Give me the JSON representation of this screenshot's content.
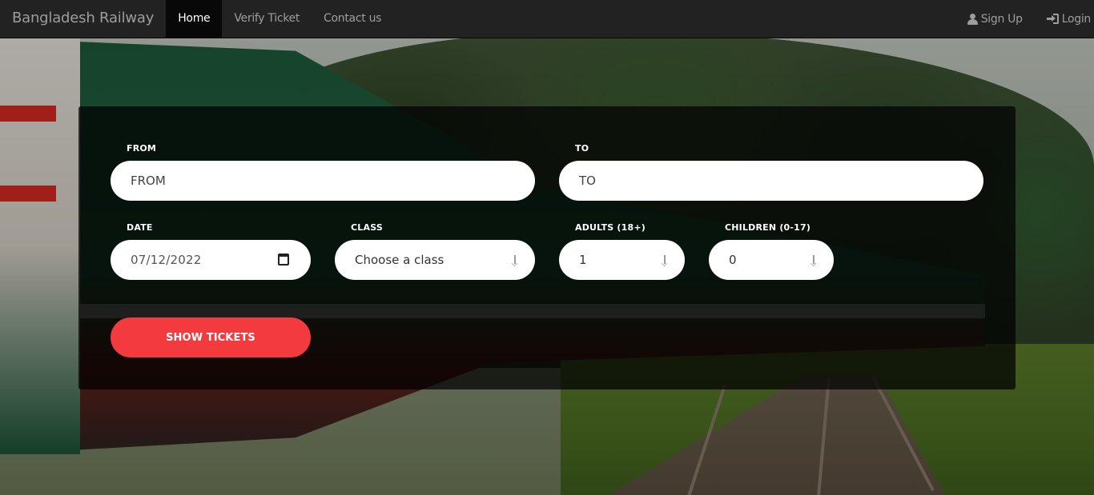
{
  "navbar": {
    "brand": "Bangladesh Railway",
    "links": [
      {
        "label": "Home",
        "active": true
      },
      {
        "label": "Verify Ticket",
        "active": false
      },
      {
        "label": "Contact us",
        "active": false
      }
    ],
    "signup_label": "Sign Up",
    "login_label": "Login"
  },
  "search": {
    "from_label": "FROM",
    "from_placeholder": "FROM",
    "to_label": "TO",
    "to_placeholder": "TO",
    "date_label": "DATE",
    "date_value": "07/12/2022",
    "class_label": "CLASS",
    "class_value": "Choose a class",
    "adults_label": "ADULTS (18+)",
    "adults_value": "1",
    "children_label": "CHILDREN (0-17)",
    "children_value": "0",
    "submit_label": "SHOW TICKETS"
  },
  "colors": {
    "navbar_bg": "#222222",
    "accent_button": "#f23a3f",
    "panel_bg": "rgba(0,0,0,0.72)"
  },
  "icons": {
    "signup": "user-icon",
    "login": "login-icon",
    "date": "calendar-icon",
    "select": "arrow-down-icon"
  }
}
